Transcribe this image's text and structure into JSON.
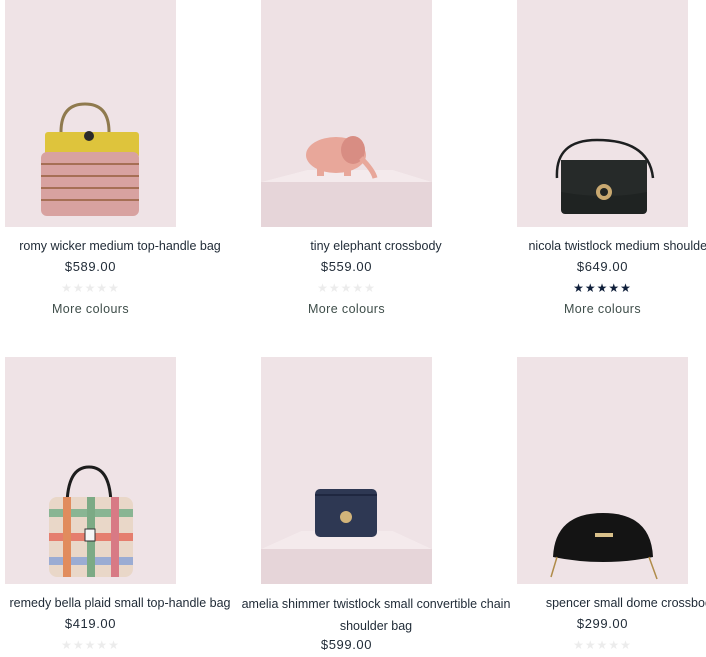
{
  "products": [
    {
      "name": "romy wicker medium top-handle bag",
      "price": "$589.00",
      "rating": 0,
      "more": "More colours",
      "icon": "wicker-bag-image"
    },
    {
      "name": "tiny elephant crossbody",
      "price": "$559.00",
      "rating": 0,
      "more": "More colours",
      "icon": "elephant-bag-image"
    },
    {
      "name": "nicola twistlock medium shoulder bag",
      "price": "$649.00",
      "rating": 5,
      "more": "More colours",
      "icon": "black-shoulder-bag-image"
    },
    {
      "name": "remedy bella plaid small top-handle bag",
      "price": "$419.00",
      "rating": 0,
      "more": "",
      "icon": "plaid-bag-image"
    },
    {
      "name": "amelia shimmer twistlock small convertible chain shoulder bag",
      "price": "$599.00",
      "rating": 0,
      "more": "",
      "icon": "navy-chain-bag-image"
    },
    {
      "name": "spencer small dome crossbody",
      "price": "$299.00",
      "rating": 0,
      "more": "",
      "icon": "black-dome-bag-image"
    }
  ],
  "colors": {
    "background": "#efe3e6",
    "star_filled": "#0f1f3a",
    "star_empty": "#ececec"
  }
}
